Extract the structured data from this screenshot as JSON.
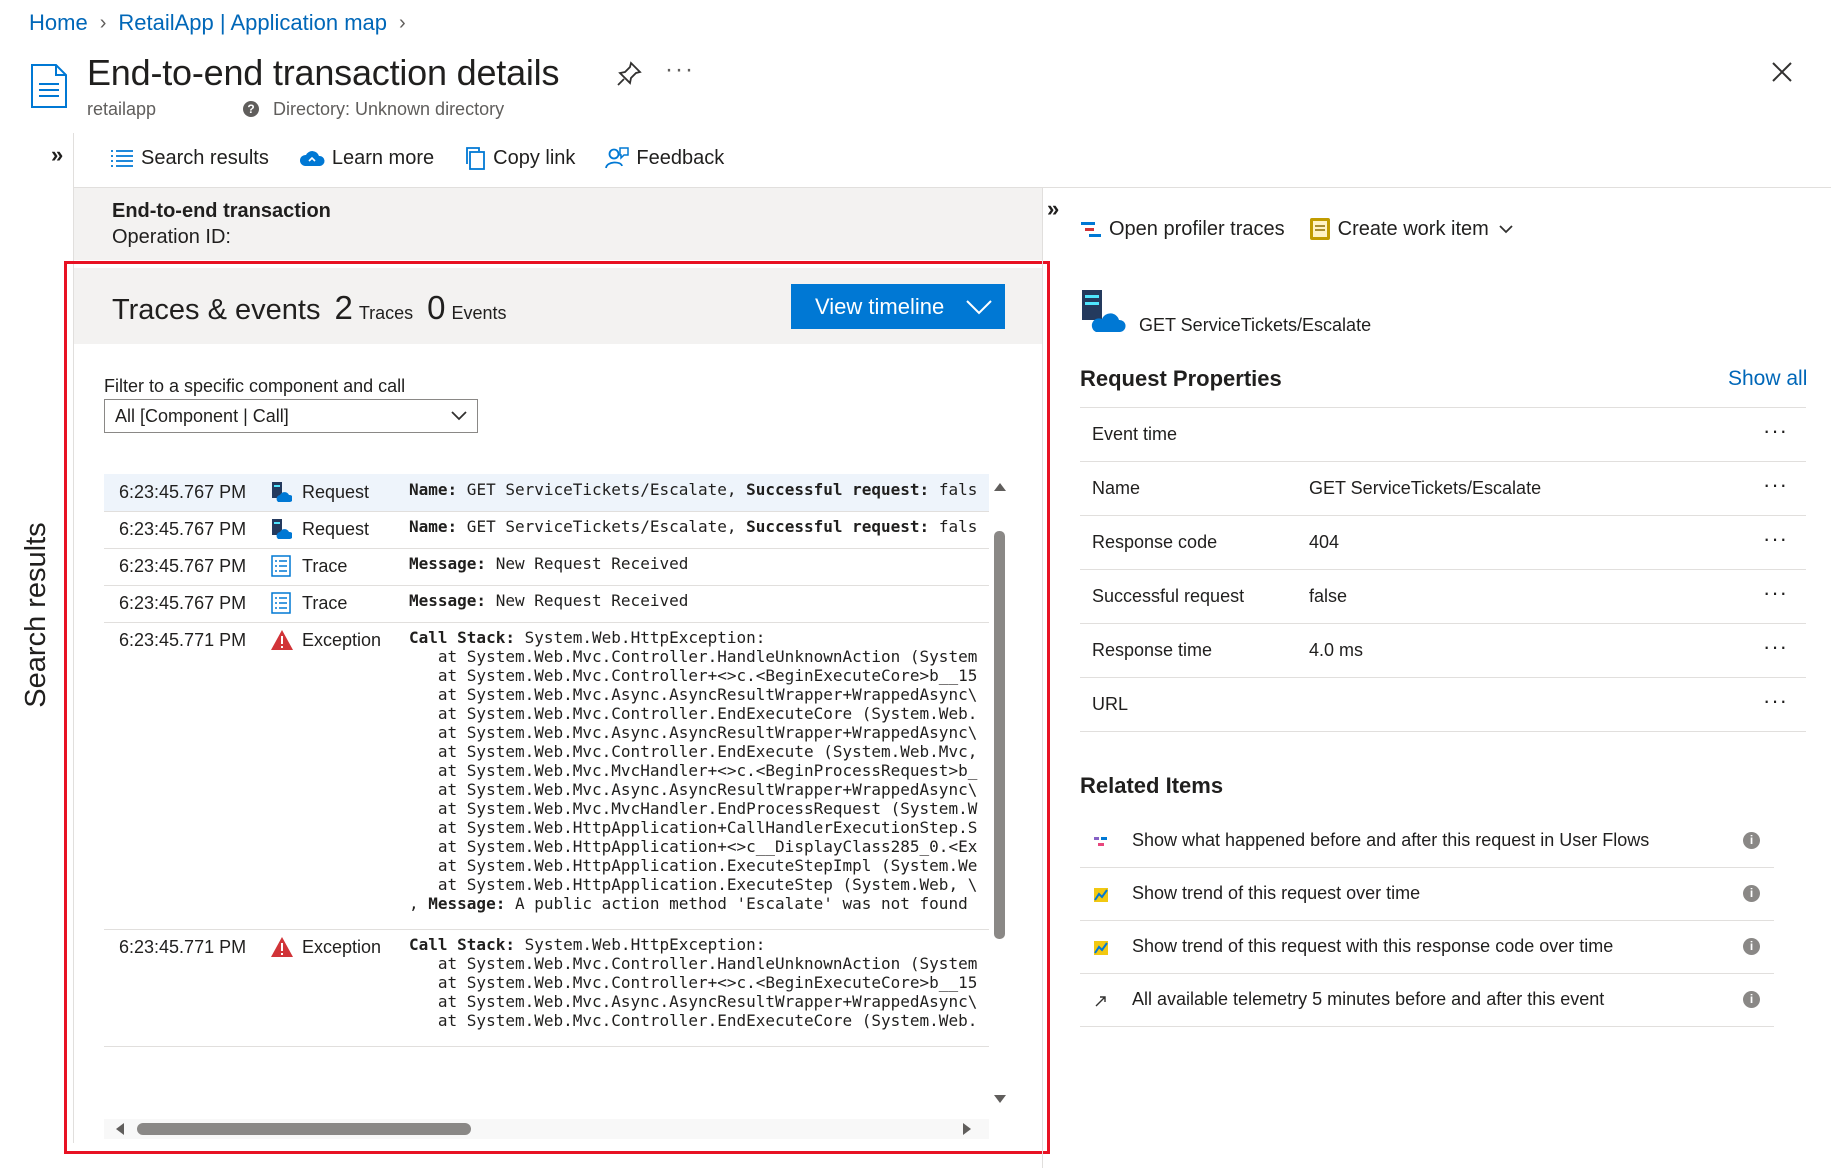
{
  "breadcrumb": {
    "home": "Home",
    "app_map": "RetailApp | Application map"
  },
  "header": {
    "title": "End-to-end transaction details",
    "resource": "retailapp",
    "directory": "Directory: Unknown directory",
    "more": "···"
  },
  "sidebar": {
    "label": "Search results",
    "expand_icon": "»"
  },
  "toolbar": {
    "search_results": "Search results",
    "learn_more": "Learn more",
    "copy_link": "Copy link",
    "feedback": "Feedback"
  },
  "transaction": {
    "title": "End-to-end transaction",
    "operation_id_label": "Operation ID:"
  },
  "traces": {
    "title": "Traces & events",
    "trace_count": "2",
    "trace_label": "Traces",
    "event_count": "0",
    "event_label": "Events",
    "view_timeline": "View timeline",
    "filter_label": "Filter to a specific component and call",
    "filter_value": "All [Component | Call]",
    "rows": [
      {
        "time": "6:23:45.767 PM",
        "type": "Request",
        "icon": "request-icon",
        "selected": true,
        "lines": [
          [
            [
              "Name:",
              "b"
            ],
            [
              " GET ServiceTickets/Escalate, ",
              ""
            ],
            [
              "Successful request:",
              "b"
            ],
            [
              " fals",
              ""
            ]
          ]
        ]
      },
      {
        "time": "6:23:45.767 PM",
        "type": "Request",
        "icon": "request-icon",
        "lines": [
          [
            [
              "Name:",
              "b"
            ],
            [
              " GET ServiceTickets/Escalate, ",
              ""
            ],
            [
              "Successful request:",
              "b"
            ],
            [
              " fals",
              ""
            ]
          ]
        ]
      },
      {
        "time": "6:23:45.767 PM",
        "type": "Trace",
        "icon": "trace-icon",
        "lines": [
          [
            [
              "Message:",
              "b"
            ],
            [
              " New Request Received",
              ""
            ]
          ]
        ]
      },
      {
        "time": "6:23:45.767 PM",
        "type": "Trace",
        "icon": "trace-icon",
        "lines": [
          [
            [
              "Message:",
              "b"
            ],
            [
              " New Request Received",
              ""
            ]
          ]
        ]
      },
      {
        "time": "6:23:45.771 PM",
        "type": "Exception",
        "icon": "exception-icon",
        "lines": [
          [
            [
              "Call Stack:",
              "b"
            ],
            [
              " System.Web.HttpException:",
              ""
            ]
          ],
          [
            [
              "   at System.Web.Mvc.Controller.HandleUnknownAction (System",
              ""
            ]
          ],
          [
            [
              "   at System.Web.Mvc.Controller+<>c.<BeginExecuteCore>b__15",
              ""
            ]
          ],
          [
            [
              "   at System.Web.Mvc.Async.AsyncResultWrapper+WrappedAsync\\",
              ""
            ]
          ],
          [
            [
              "   at System.Web.Mvc.Controller.EndExecuteCore (System.Web.",
              ""
            ]
          ],
          [
            [
              "   at System.Web.Mvc.Async.AsyncResultWrapper+WrappedAsync\\",
              ""
            ]
          ],
          [
            [
              "   at System.Web.Mvc.Controller.EndExecute (System.Web.Mvc,",
              ""
            ]
          ],
          [
            [
              "   at System.Web.Mvc.MvcHandler+<>c.<BeginProcessRequest>b_",
              ""
            ]
          ],
          [
            [
              "   at System.Web.Mvc.Async.AsyncResultWrapper+WrappedAsync\\",
              ""
            ]
          ],
          [
            [
              "   at System.Web.Mvc.MvcHandler.EndProcessRequest (System.W",
              ""
            ]
          ],
          [
            [
              "   at System.Web.HttpApplication+CallHandlerExecutionStep.S",
              ""
            ]
          ],
          [
            [
              "   at System.Web.HttpApplication+<>c__DisplayClass285_0.<Ex",
              ""
            ]
          ],
          [
            [
              "   at System.Web.HttpApplication.ExecuteStepImpl (System.We",
              ""
            ]
          ],
          [
            [
              "   at System.Web.HttpApplication.ExecuteStep (System.Web, \\",
              ""
            ]
          ],
          [
            [
              ", ",
              ""
            ],
            [
              "Message:",
              "b"
            ],
            [
              " A public action method 'Escalate' was not found",
              ""
            ]
          ]
        ]
      },
      {
        "time": "6:23:45.771 PM",
        "type": "Exception",
        "icon": "exception-icon",
        "lines": [
          [
            [
              "Call Stack:",
              "b"
            ],
            [
              " System.Web.HttpException:",
              ""
            ]
          ],
          [
            [
              "   at System.Web.Mvc.Controller.HandleUnknownAction (System",
              ""
            ]
          ],
          [
            [
              "   at System.Web.Mvc.Controller+<>c.<BeginExecuteCore>b__15",
              ""
            ]
          ],
          [
            [
              "   at System.Web.Mvc.Async.AsyncResultWrapper+WrappedAsync\\",
              ""
            ]
          ],
          [
            [
              "   at System.Web.Mvc.Controller.EndExecuteCore (System.Web.",
              ""
            ]
          ]
        ]
      }
    ]
  },
  "details": {
    "expand_icon": "»",
    "open_profiler": "Open profiler traces",
    "create_work_item": "Create work item",
    "request_name": "GET ServiceTickets/Escalate",
    "properties_title": "Request Properties",
    "show_all": "Show all",
    "properties": [
      {
        "key": "Event time",
        "value": ""
      },
      {
        "key": "Name",
        "value": "GET ServiceTickets/Escalate"
      },
      {
        "key": "Response code",
        "value": "404"
      },
      {
        "key": "Successful request",
        "value": "false"
      },
      {
        "key": "Response time",
        "value": "4.0 ms"
      },
      {
        "key": "URL",
        "value": ""
      }
    ],
    "related_title": "Related Items",
    "related": [
      {
        "label": "Show what happened before and after this request in User Flows",
        "icon": "user-flows-icon"
      },
      {
        "label": "Show trend of this request over time",
        "icon": "trend-chart-icon"
      },
      {
        "label": "Show trend of this request with this response code over time",
        "icon": "trend-chart-icon"
      },
      {
        "label": "All available telemetry 5 minutes before and after this event",
        "icon": "arrow-out-icon"
      }
    ]
  },
  "colors": {
    "accent": "#0078d4",
    "link": "#0067b8",
    "highlight_frame": "#e81123",
    "error": "#d13438"
  }
}
